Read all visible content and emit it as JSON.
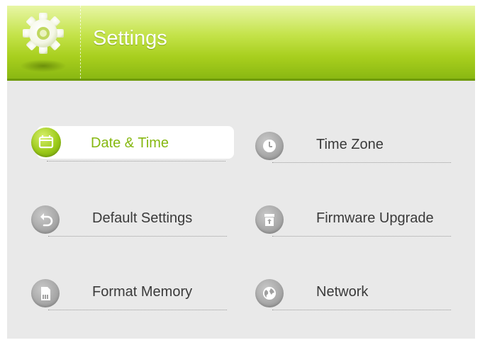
{
  "header": {
    "title": "Settings",
    "icon": "gear-icon",
    "colors": {
      "green_top": "#e8f6a6",
      "green_mid": "#c4e34a",
      "green_bottom": "#8ab812"
    }
  },
  "menu": {
    "items": [
      {
        "label": "Date & Time",
        "icon": "calendar-icon",
        "active": true
      },
      {
        "label": "Time Zone",
        "icon": "clock-icon",
        "active": false
      },
      {
        "label": "Default Settings",
        "icon": "undo-icon",
        "active": false
      },
      {
        "label": "Firmware Upgrade",
        "icon": "firmware-icon",
        "active": false
      },
      {
        "label": "Format Memory",
        "icon": "memory-card-icon",
        "active": false
      },
      {
        "label": "Network",
        "icon": "globe-icon",
        "active": false
      }
    ],
    "colors": {
      "active_text": "#86b811",
      "text": "#3a3a3a",
      "icon_gray": "#a9a9a9"
    }
  }
}
